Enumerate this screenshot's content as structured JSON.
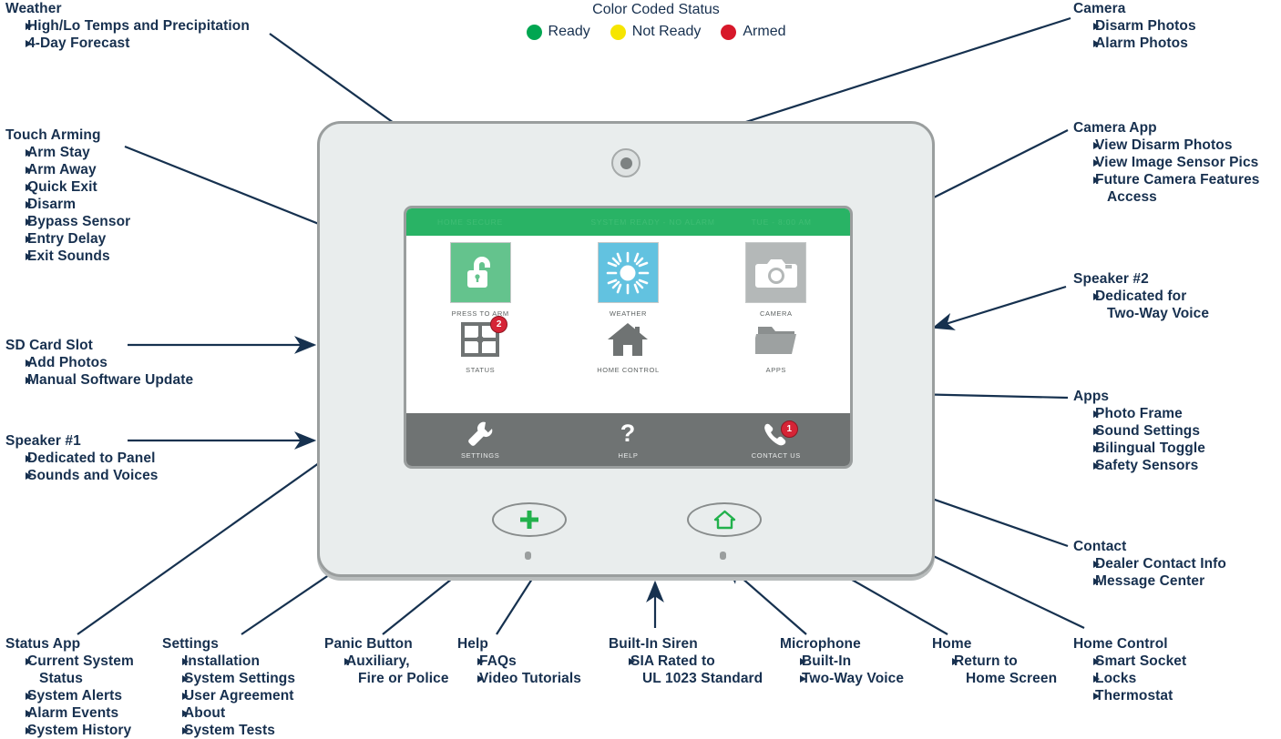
{
  "legend": {
    "title": "Color Coded Status",
    "items": [
      {
        "label": "Ready",
        "color": "#00a651"
      },
      {
        "label": "Not Ready",
        "color": "#f6e500"
      },
      {
        "label": "Armed",
        "color": "#d7182a"
      }
    ]
  },
  "annotations": [
    {
      "id": "weather",
      "title": "Weather",
      "items": [
        "High/Lo Temps and Precipitation",
        "4-Day Forecast"
      ]
    },
    {
      "id": "touch-arming",
      "title": "Touch Arming",
      "items": [
        "Arm Stay",
        "Arm Away",
        "Quick Exit",
        "Disarm",
        "Bypass Sensor",
        "Entry Delay",
        "Exit Sounds"
      ]
    },
    {
      "id": "sd-card-slot",
      "title": "SD Card Slot",
      "items": [
        "Add Photos",
        "Manual Software Update"
      ]
    },
    {
      "id": "speaker-1",
      "title": "Speaker #1",
      "items": [
        "Dedicated to Panel",
        "Sounds and Voices"
      ]
    },
    {
      "id": "camera",
      "title": "Camera",
      "items": [
        "Disarm Photos",
        "Alarm Photos"
      ]
    },
    {
      "id": "camera-app",
      "title": "Camera App",
      "items": [
        "View Disarm Photos",
        "View Image Sensor Pics",
        "Future Camera Features"
      ],
      "continuation": "Access"
    },
    {
      "id": "speaker-2",
      "title": "Speaker #2",
      "items": [
        "Dedicated for"
      ],
      "continuation": "Two-Way Voice"
    },
    {
      "id": "apps",
      "title": "Apps",
      "items": [
        "Photo Frame",
        "Sound Settings",
        "Bilingual Toggle",
        "Safety Sensors"
      ]
    },
    {
      "id": "contact",
      "title": "Contact",
      "items": [
        "Dealer Contact Info",
        "Message Center"
      ]
    },
    {
      "id": "status-app",
      "title": "Status App",
      "items": [
        "Current System",
        "System Alerts",
        "Alarm Events",
        "System History"
      ],
      "inline_continuation": {
        "after": 0,
        "text": "Status"
      }
    },
    {
      "id": "settings",
      "title": "Settings",
      "items": [
        "Installation",
        "System Settings",
        "User Agreement",
        "About",
        "System Tests"
      ]
    },
    {
      "id": "panic-button",
      "title": "Panic Button",
      "items": [
        "Auxiliary,"
      ],
      "continuation": "Fire or Police"
    },
    {
      "id": "help",
      "title": "Help",
      "items": [
        "FAQs",
        "Video Tutorials"
      ]
    },
    {
      "id": "built-in-siren",
      "title": "Built-In Siren",
      "items": [
        "SIA Rated to"
      ],
      "continuation": "UL 1023 Standard"
    },
    {
      "id": "microphone",
      "title": "Microphone",
      "items": [
        "Built-In",
        "Two-Way Voice"
      ]
    },
    {
      "id": "home",
      "title": "Home",
      "items": [
        "Return to"
      ],
      "continuation": "Home Screen"
    },
    {
      "id": "home-control",
      "title": "Home Control",
      "items": [
        "Smart Socket",
        "Locks",
        "Thermostat"
      ]
    }
  ],
  "device": {
    "statusbar": {
      "left": "HOME SECURE",
      "center": "SYSTEM READY - NO ALARM",
      "right": "TUE - 8:00 AM",
      "color": "#29b365"
    },
    "tiles": [
      {
        "label": "PRESS TO ARM",
        "icon": "unlock-icon",
        "tile_color": "#64c38d"
      },
      {
        "label": "WEATHER",
        "icon": "sun-icon",
        "tile_color": "#62c2e0"
      },
      {
        "label": "CAMERA",
        "icon": "camera-icon",
        "tile_color": "#b4b8b8"
      }
    ],
    "apps": [
      {
        "label": "STATUS",
        "icon": "window-sensor-icon",
        "badge": "2"
      },
      {
        "label": "HOME CONTROL",
        "icon": "house-icon",
        "badge": ""
      },
      {
        "label": "APPS",
        "icon": "folder-icon",
        "badge": ""
      }
    ],
    "bottombar": [
      {
        "label": "SETTINGS",
        "icon": "wrench-icon",
        "badge": ""
      },
      {
        "label": "HELP",
        "icon": "question-mark-icon",
        "badge": ""
      },
      {
        "label": "CONTACT US",
        "icon": "phone-icon",
        "badge": "1"
      }
    ],
    "hardware": {
      "panic_label": "panic-plus-icon",
      "home_label": "home-house-icon",
      "accent_green": "#22b14c"
    }
  }
}
